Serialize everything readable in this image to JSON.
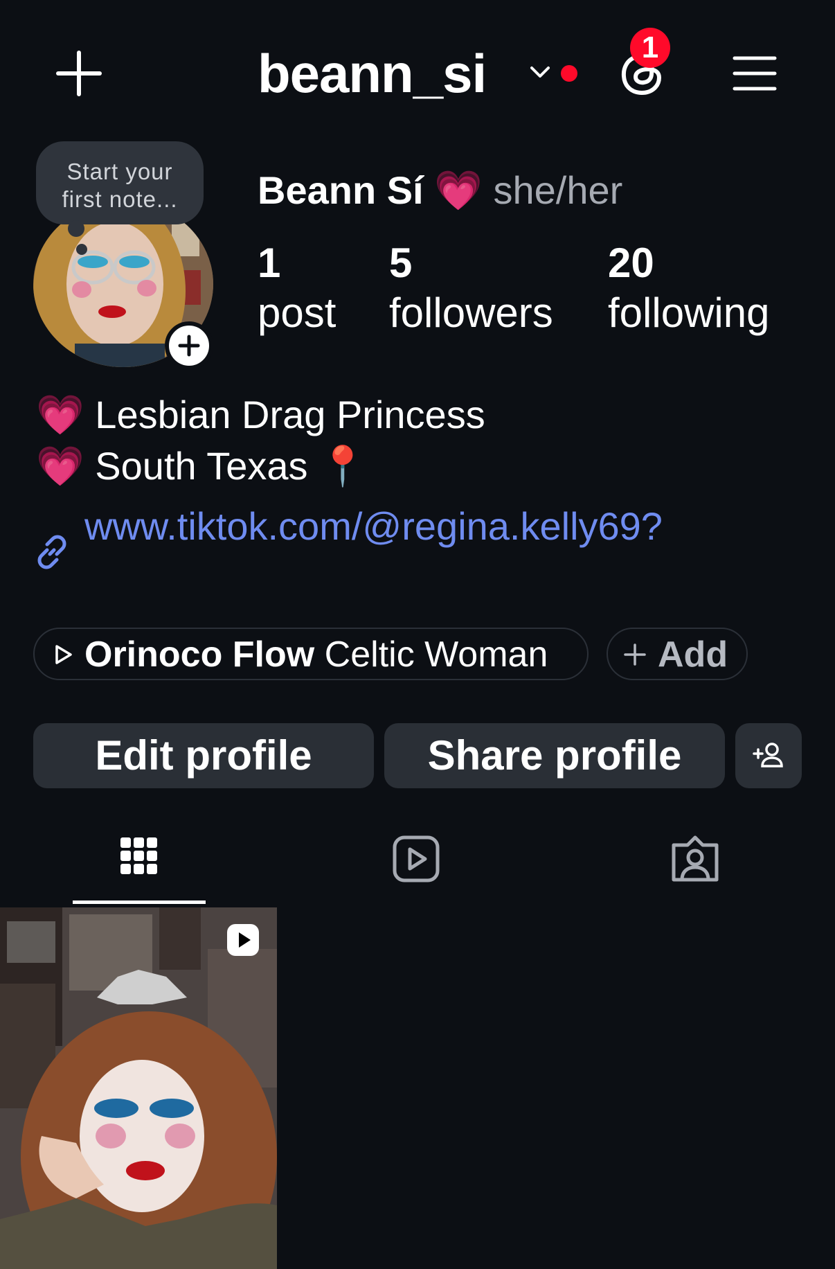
{
  "header": {
    "username": "beann_si",
    "threads_badge_count": "1"
  },
  "note": {
    "text_line1": "Start your",
    "text_line2": "first note..."
  },
  "profile": {
    "display_name": "Beann Sí",
    "name_emoji": "💗",
    "pronouns": "she/her"
  },
  "stats": {
    "posts": {
      "value": "1",
      "label": "post"
    },
    "followers": {
      "value": "5",
      "label": "followers"
    },
    "following": {
      "value": "20",
      "label": "following"
    }
  },
  "bio": {
    "line1_emoji": "💗",
    "line1_text": "Lesbian Drag Princess",
    "line2_emoji": "💗",
    "line2_text": "South Texas",
    "line2_trailing_emoji": "📍",
    "link": "www.tiktok.com/@regina.kelly69?"
  },
  "music": {
    "title": "Orinoco Flow",
    "artist": "Celtic Woman",
    "add_label": "Add"
  },
  "actions": {
    "edit_profile": "Edit profile",
    "share_profile": "Share profile"
  },
  "tabs": [
    "grid-icon",
    "reels-icon",
    "tagged-icon"
  ],
  "icons": {
    "new_post": "plus-icon",
    "dropdown": "chevron-down-icon",
    "threads": "threads-icon",
    "menu": "hamburger-menu-icon",
    "link": "link-icon",
    "discover": "add-person-icon",
    "reel_badge": "reel-play-icon"
  },
  "colors": {
    "background": "#0c0f14",
    "button_bg": "#2a2f36",
    "link": "#6f8cf0",
    "notification_red": "#ff0a2a",
    "secondary_text": "#a6aab2"
  }
}
